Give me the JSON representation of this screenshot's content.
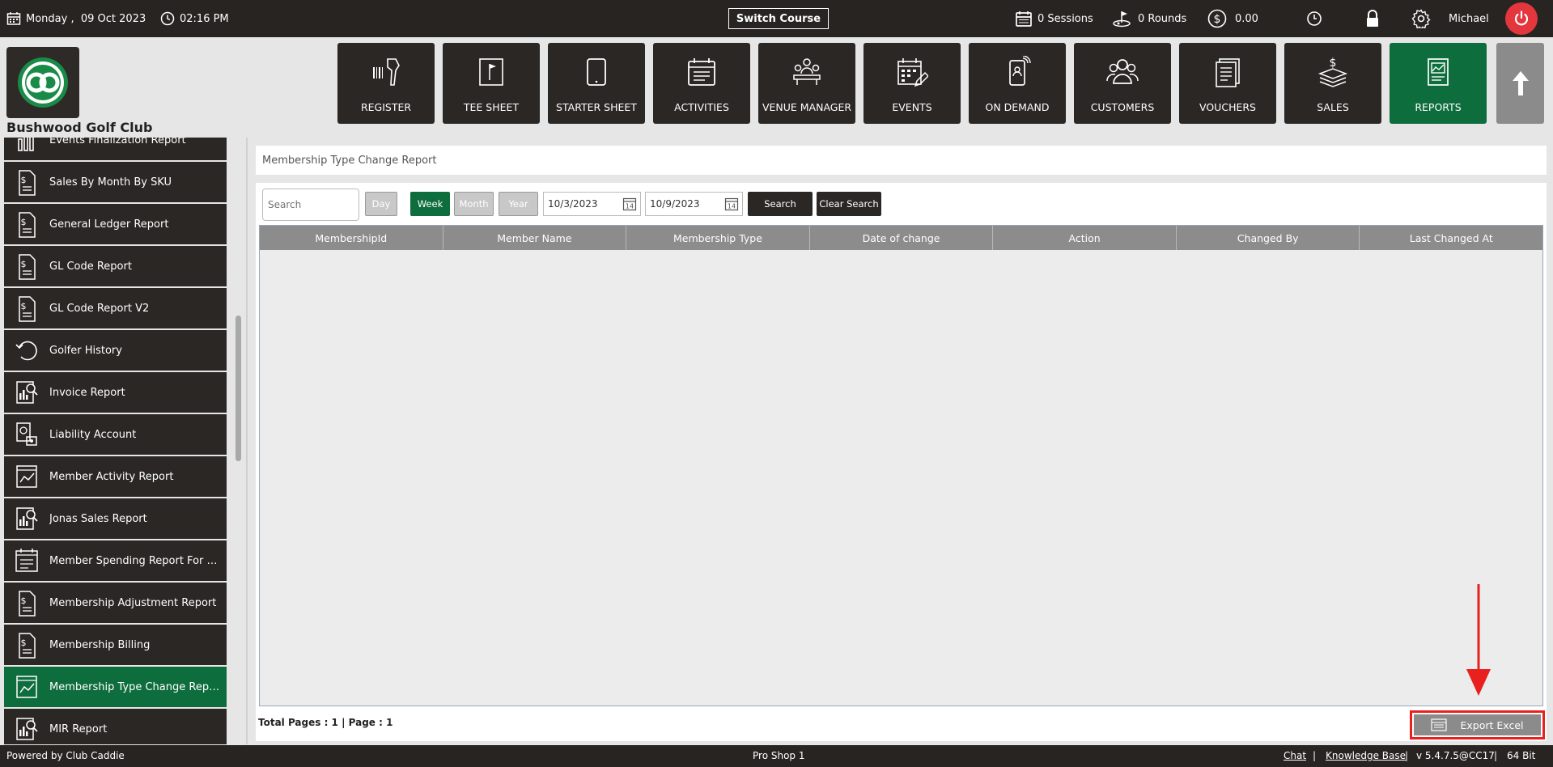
{
  "topbar": {
    "date": "Monday ,  09 Oct 2023",
    "time": "02:16 PM",
    "switch_course": "Switch Course",
    "sessions": "0 Sessions",
    "rounds": "0 Rounds",
    "balance": "0.00",
    "user": "Michael"
  },
  "club": {
    "name": "Bushwood Golf Club"
  },
  "nav": [
    {
      "label": "REGISTER",
      "icon": "scanner-icon"
    },
    {
      "label": "TEE SHEET",
      "icon": "flag-sheet-icon"
    },
    {
      "label": "STARTER SHEET",
      "icon": "tablet-icon"
    },
    {
      "label": "ACTIVITIES",
      "icon": "calendar-list-icon"
    },
    {
      "label": "VENUE MANAGER",
      "icon": "meeting-icon"
    },
    {
      "label": "EVENTS",
      "icon": "calendar-edit-icon"
    },
    {
      "label": "ON DEMAND",
      "icon": "phone-icon"
    },
    {
      "label": "CUSTOMERS",
      "icon": "people-icon"
    },
    {
      "label": "VOUCHERS",
      "icon": "voucher-icon"
    },
    {
      "label": "SALES",
      "icon": "money-stack-icon"
    },
    {
      "label": "REPORTS",
      "icon": "report-icon",
      "active": true
    }
  ],
  "sidebar": {
    "items": [
      {
        "label": "Events Finalization Report",
        "icon": "bar-chart-icon"
      },
      {
        "label": "Sales By Month By SKU",
        "icon": "dollar-doc-icon"
      },
      {
        "label": "General Ledger Report",
        "icon": "dollar-doc-icon"
      },
      {
        "label": "GL Code Report",
        "icon": "dollar-doc-icon"
      },
      {
        "label": "GL Code Report V2",
        "icon": "dollar-doc-icon"
      },
      {
        "label": "Golfer History",
        "icon": "history-icon"
      },
      {
        "label": "Invoice Report",
        "icon": "analysis-doc-icon"
      },
      {
        "label": "Liability Account",
        "icon": "liability-icon"
      },
      {
        "label": "Member Activity Report",
        "icon": "line-doc-icon"
      },
      {
        "label": "Jonas Sales Report",
        "icon": "analysis-doc-icon"
      },
      {
        "label": "Member Spending Report For Minim...",
        "icon": "calendar-doc-icon"
      },
      {
        "label": "Membership Adjustment Report",
        "icon": "dollar-doc-icon"
      },
      {
        "label": "Membership Billing",
        "icon": "dollar-doc-icon"
      },
      {
        "label": "Membership Type Change Report",
        "icon": "line-doc-icon",
        "active": true
      },
      {
        "label": "MIR Report",
        "icon": "analysis-doc-icon"
      }
    ]
  },
  "report": {
    "title": "Membership Type Change Report",
    "search_placeholder": "Search",
    "period_buttons": [
      "Day",
      "Week",
      "Month",
      "Year"
    ],
    "date_from": "10/3/2023",
    "date_to": "10/9/2023",
    "calendar_day": "14",
    "search_label": "Search",
    "clear_label": "Clear Search",
    "columns": [
      "MembershipId",
      "Member Name",
      "Membership Type",
      "Date of change",
      "Action",
      "Changed By",
      "Last Changed At"
    ],
    "total_pages": "Total Pages : 1 | Page : 1",
    "export_label": "Export Excel"
  },
  "footer": {
    "powered_by": "Powered by Club Caddie",
    "location": "Pro Shop 1",
    "chat": "Chat",
    "knowledge_base": "Knowledge Base",
    "version": "v 5.4.7.5@CC17",
    "bitness": "64 Bit",
    "separator": "|"
  },
  "colors": {
    "dark": "#2a2725",
    "green": "#0e6d3d",
    "power_red": "#e4363d",
    "highlight_red": "#e8211f"
  }
}
